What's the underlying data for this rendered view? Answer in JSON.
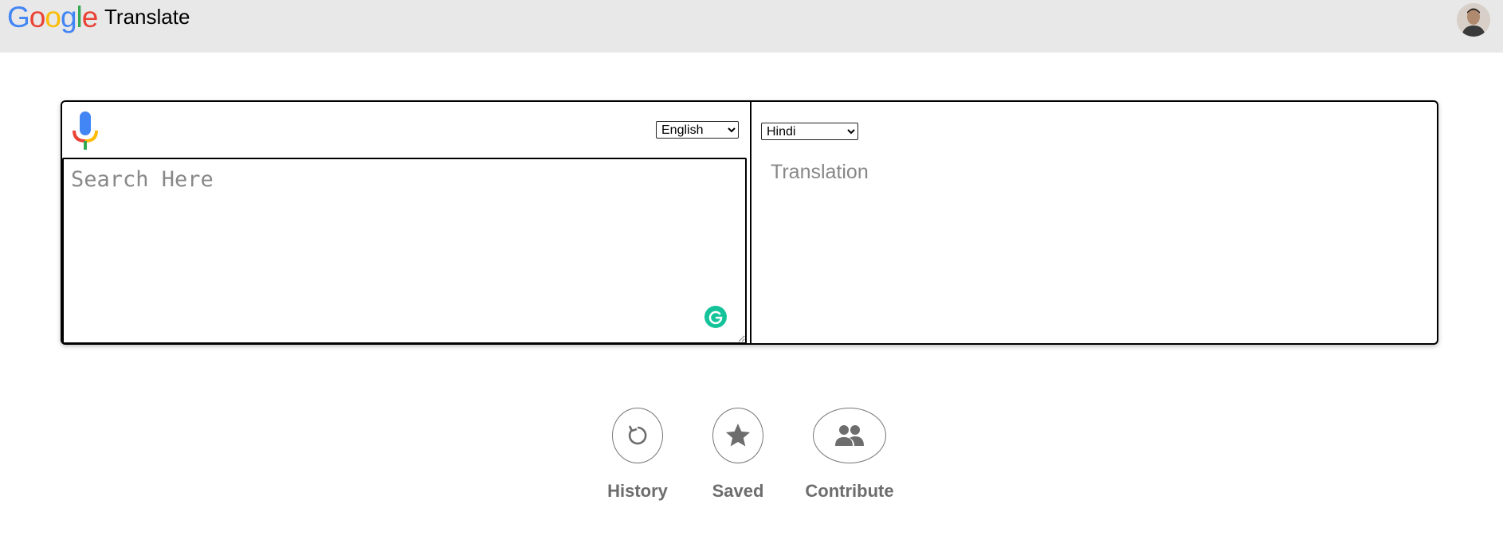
{
  "header": {
    "logo_text": "Google",
    "logo_letters": [
      {
        "ch": "G",
        "color": "#4285F4"
      },
      {
        "ch": "o",
        "color": "#EA4335"
      },
      {
        "ch": "o",
        "color": "#FBBC05"
      },
      {
        "ch": "g",
        "color": "#4285F4"
      },
      {
        "ch": "l",
        "color": "#34A853"
      },
      {
        "ch": "e",
        "color": "#EA4335"
      }
    ],
    "title": "Translate",
    "avatar_icon": "user-avatar"
  },
  "translator": {
    "mic_icon": "microphone-icon",
    "source_language": {
      "selected": "English",
      "options": [
        "English"
      ]
    },
    "target_language": {
      "selected": "Hindi",
      "options": [
        "Hindi"
      ]
    },
    "search_placeholder": "Search Here",
    "search_value": "",
    "translation_placeholder": "Translation",
    "grammarly_icon": "grammarly-icon"
  },
  "actions": [
    {
      "label": "History",
      "icon": "history-icon"
    },
    {
      "label": "Saved",
      "icon": "star-icon"
    },
    {
      "label": "Contribute",
      "icon": "people-icon"
    }
  ],
  "colors": {
    "header_bg": "#e8e8e8",
    "action_label": "#6d6d6d",
    "grammarly": "#15c39a",
    "mic_blue": "#4285F4",
    "mic_red": "#EA4335",
    "mic_yellow": "#FBBC05",
    "mic_green": "#34A853"
  }
}
